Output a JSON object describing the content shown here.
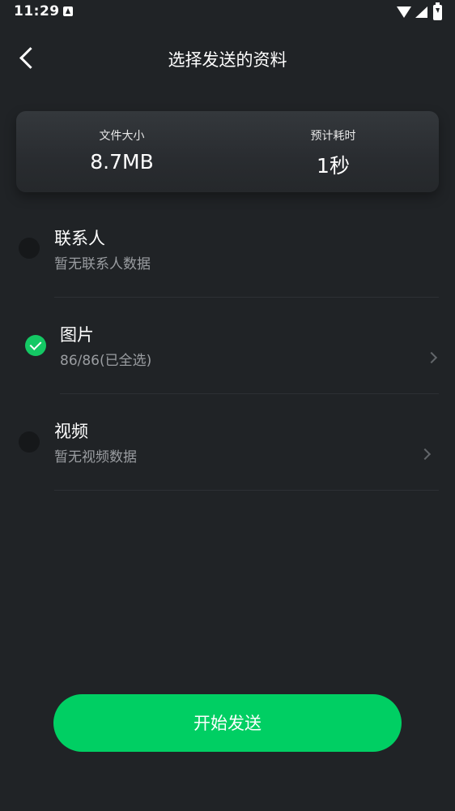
{
  "status_bar": {
    "time": "11:29"
  },
  "header": {
    "title": "选择发送的资料"
  },
  "summary": {
    "file_size_label": "文件大小",
    "file_size_value": "8.7MB",
    "time_label": "预计耗时",
    "time_value": "1秒"
  },
  "categories": [
    {
      "title": "联系人",
      "subtitle": "暂无联系人数据",
      "selected": false
    },
    {
      "title": "图片",
      "subtitle": "86/86(已全选)",
      "selected": true
    },
    {
      "title": "视频",
      "subtitle": "暂无视频数据",
      "selected": false
    }
  ],
  "start_button": {
    "label": "开始发送"
  },
  "colors": {
    "background": "#202326",
    "accent": "#00cf63",
    "check": "#14c864",
    "subtitle": "#9a9da1"
  },
  "icons": {
    "back": "back-icon",
    "check": "check-icon",
    "chevron": "chevron-right-icon"
  }
}
